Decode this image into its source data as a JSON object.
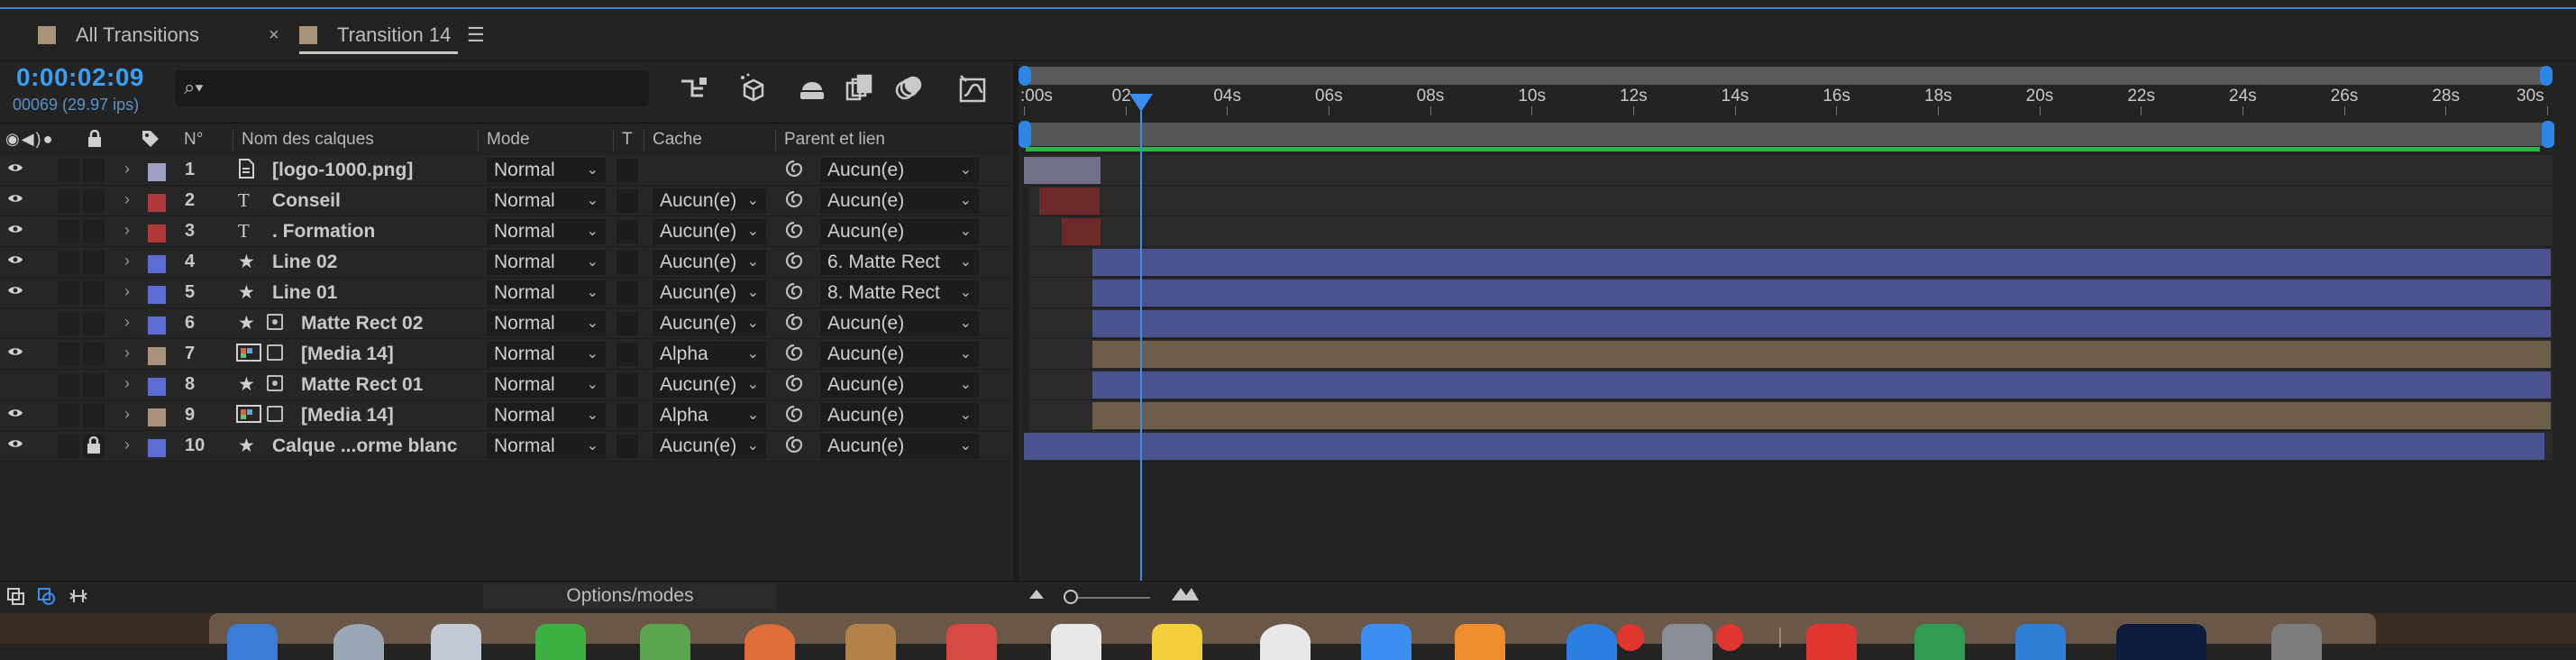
{
  "tabs": [
    {
      "label": "All Transitions",
      "active": false
    },
    {
      "label": "Transition 14",
      "active": true
    }
  ],
  "tab_close": "×",
  "tab_menu": "☰",
  "timecode": "0:00:02:09",
  "frame_info": "00069 (29.97 ips)",
  "search_icon": "⌕▾",
  "columns": {
    "num": "N°",
    "name": "Nom des calques",
    "mode": "Mode",
    "t": "T",
    "cache": "Cache",
    "parent": "Parent et lien"
  },
  "layers": [
    {
      "num": "1",
      "type": "file",
      "name": "[logo-1000.png]",
      "mode": "Normal",
      "cache": "",
      "parent": "Aucun(e)",
      "label_color": "#9f9fc3",
      "eye": true,
      "locked": false
    },
    {
      "num": "2",
      "type": "text",
      "name": "Conseil",
      "mode": "Normal",
      "cache": "Aucun(e)",
      "parent": "Aucun(e)",
      "label_color": "#b03a3a",
      "eye": true,
      "locked": false
    },
    {
      "num": "3",
      "type": "text",
      "name": ". Formation",
      "mode": "Normal",
      "cache": "Aucun(e)",
      "parent": "Aucun(e)",
      "label_color": "#b03a3a",
      "eye": true,
      "locked": false
    },
    {
      "num": "4",
      "type": "shape",
      "name": "Line 02",
      "mode": "Normal",
      "cache": "Aucun(e)",
      "parent": "6. Matte Rect",
      "label_color": "#5b6cd4",
      "eye": true,
      "locked": false
    },
    {
      "num": "5",
      "type": "shape",
      "name": "Line 01",
      "mode": "Normal",
      "cache": "Aucun(e)",
      "parent": "8. Matte Rect",
      "label_color": "#5b6cd4",
      "eye": true,
      "locked": false
    },
    {
      "num": "6",
      "type": "shape-matte",
      "name": "Matte Rect 02",
      "mode": "Normal",
      "cache": "Aucun(e)",
      "parent": "Aucun(e)",
      "label_color": "#5b6cd4",
      "eye": false,
      "locked": false
    },
    {
      "num": "7",
      "type": "precomp",
      "name": "[Media 14]",
      "mode": "Normal",
      "cache": "Alpha",
      "parent": "Aucun(e)",
      "label_color": "#a8927a",
      "eye": true,
      "locked": false
    },
    {
      "num": "8",
      "type": "shape-matte",
      "name": "Matte Rect 01",
      "mode": "Normal",
      "cache": "Aucun(e)",
      "parent": "Aucun(e)",
      "label_color": "#5b6cd4",
      "eye": false,
      "locked": false
    },
    {
      "num": "9",
      "type": "precomp",
      "name": "[Media 14]",
      "mode": "Normal",
      "cache": "Alpha",
      "parent": "Aucun(e)",
      "label_color": "#a8927a",
      "eye": true,
      "locked": false
    },
    {
      "num": "10",
      "type": "shape",
      "name": "Calque ...orme blanc",
      "mode": "Normal",
      "cache": "Aucun(e)",
      "parent": "Aucun(e)",
      "label_color": "#5b6cd4",
      "eye": true,
      "locked": true
    }
  ],
  "ruler_ticks": [
    ":00s",
    "02",
    "04s",
    "06s",
    "08s",
    "10s",
    "12s",
    "14s",
    "16s",
    "18s",
    "20s",
    "22s",
    "24s",
    "26s",
    "28s",
    "30s"
  ],
  "ruler_seconds": [
    0,
    2,
    4,
    6,
    8,
    10,
    12,
    14,
    16,
    18,
    20,
    22,
    24,
    26,
    28,
    30
  ],
  "playhead_seconds": 2.3,
  "duration_seconds": 30,
  "clips": [
    {
      "start": 0,
      "end": 1.5,
      "color": "#707088"
    },
    {
      "start": 0.3,
      "end": 1.5,
      "color": "#6e2a2a"
    },
    {
      "start": 0.75,
      "end": 1.5,
      "color": "#6e2a2a"
    },
    {
      "start": 1.35,
      "end": 30.2,
      "color": "#4a528f"
    },
    {
      "start": 1.35,
      "end": 30.2,
      "color": "#4a528f"
    },
    {
      "start": 1.35,
      "end": 30.2,
      "color": "#4a528f"
    },
    {
      "start": 1.35,
      "end": 30.2,
      "color": "#6c5e48"
    },
    {
      "start": 1.35,
      "end": 30.2,
      "color": "#4a528f"
    },
    {
      "start": 1.35,
      "end": 30.2,
      "color": "#6c5e48"
    },
    {
      "start": 0,
      "end": 29.95,
      "color": "#4a528f"
    }
  ],
  "bottom": {
    "options_label": "Options/modes"
  },
  "colors": {
    "accent": "#2d8ceb",
    "green": "#2fb24a"
  }
}
